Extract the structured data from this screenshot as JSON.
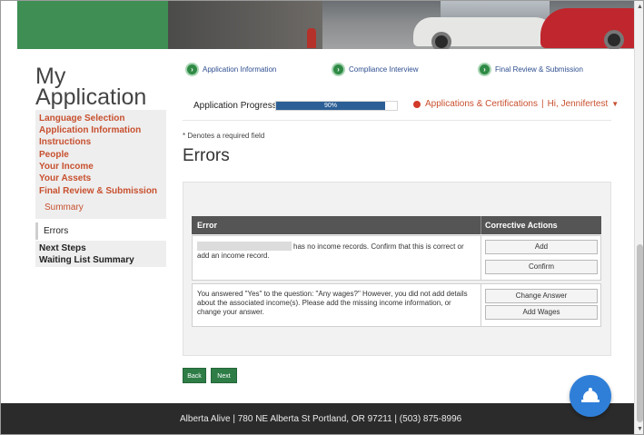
{
  "steps": [
    {
      "label": "Application Information"
    },
    {
      "label": "Compliance Interview"
    },
    {
      "label": "Final Review & Submission"
    }
  ],
  "sidebar": {
    "title_line1": "My",
    "title_line2": "Application",
    "links": [
      "Language Selection",
      "Application Information",
      "Instructions",
      "People",
      "Your Income",
      "Your Assets",
      "Final Review & Submission"
    ],
    "summary": "Summary",
    "active": "Errors",
    "after": [
      "Next Steps",
      "Waiting List Summary"
    ]
  },
  "progress": {
    "label": "Application Progress",
    "text": "90%",
    "value": 0.9
  },
  "header": {
    "apps_link": "Applications & Certifications",
    "separator": "|",
    "user": "Hi, Jennifertest"
  },
  "page": {
    "required_note": "* Denotes a required field",
    "heading": "Errors"
  },
  "table": {
    "col_error": "Error",
    "col_actions": "Corrective Actions",
    "rows": [
      {
        "text": "has no income records. Confirm that this is correct or add an income record.",
        "actions": [
          "Add",
          "Confirm"
        ]
      },
      {
        "text": "You answered \"Yes\" to the question: \"Any wages?\" However, you did not add details about the associated income(s). Please add the missing income information, or change your answer.",
        "actions": [
          "Change Answer",
          "Add Wages"
        ]
      }
    ]
  },
  "nav": {
    "back": "Back",
    "next": "Next"
  },
  "footer": {
    "text": "Alberta Alive  |  780 NE Alberta St  Portland, OR 97211  |  (503) 875-8996"
  },
  "icons": {
    "step": "chevron-right-icon",
    "chat": "bell-icon"
  },
  "colors": {
    "brand_green": "#2e7d46",
    "link_orange": "#c8502f",
    "progress_blue": "#2c5f96",
    "chat_blue": "#2f7fd8",
    "footer_dark": "#2b2b2b"
  }
}
